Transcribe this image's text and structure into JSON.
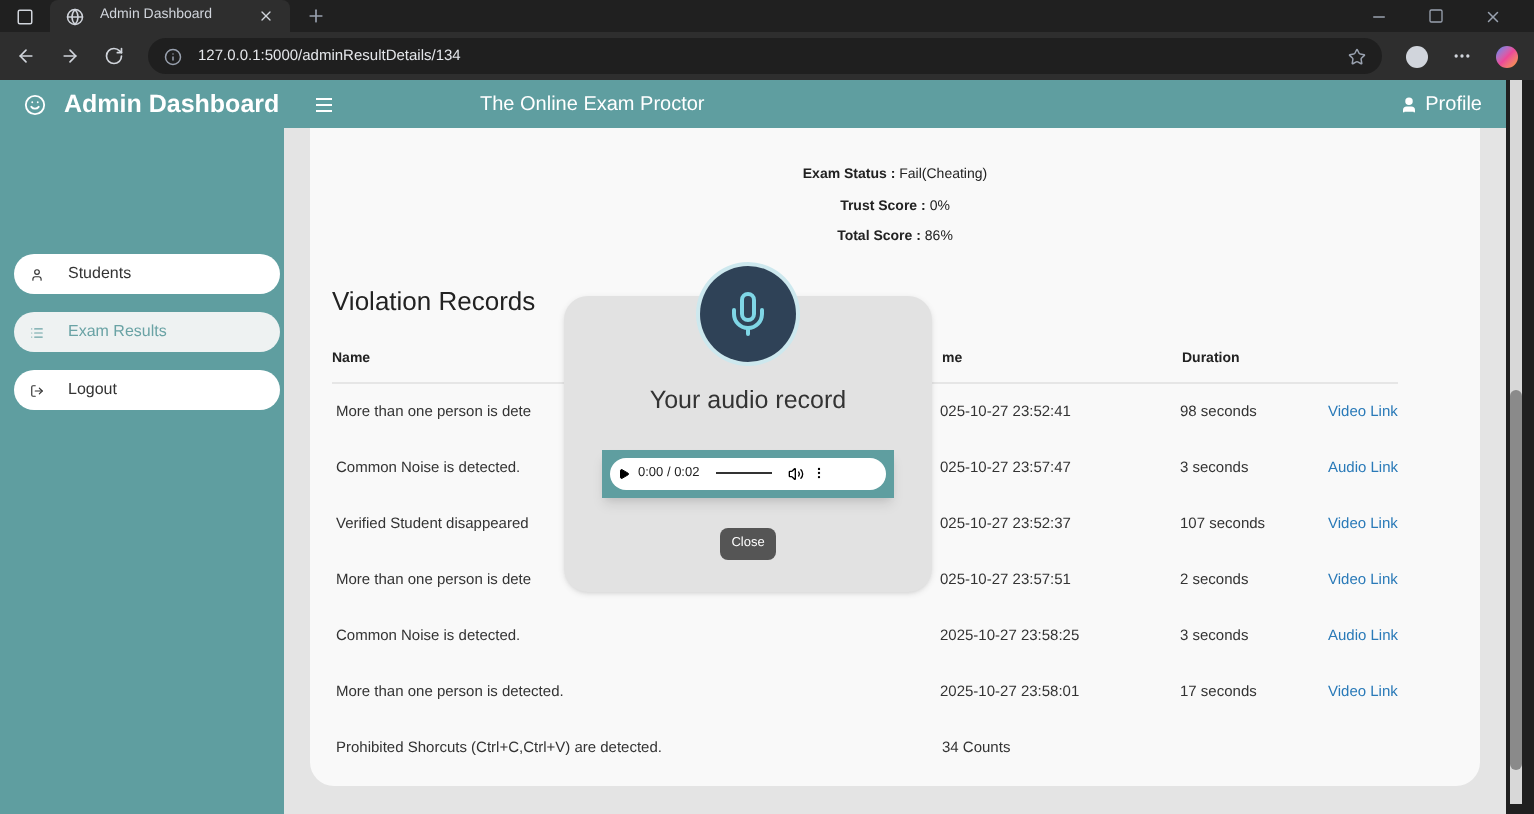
{
  "browser": {
    "tab_title": "Admin Dashboard",
    "url": "127.0.0.1:5000/adminResultDetails/134"
  },
  "header": {
    "title": "Admin Dashboard",
    "tagline": "The Online Exam Proctor",
    "profile": "Profile"
  },
  "sidebar": {
    "items": [
      {
        "label": "Students",
        "selected": false
      },
      {
        "label": "Exam Results",
        "selected": true
      },
      {
        "label": "Logout",
        "selected": false
      }
    ]
  },
  "summary": [
    {
      "label": "Exam Status :",
      "value": "Fail(Cheating)"
    },
    {
      "label": "Trust Score :",
      "value": "0%"
    },
    {
      "label": "Total Score :",
      "value": "86%"
    }
  ],
  "section_title": "Violation Records",
  "table": {
    "columns": [
      "Name",
      "me",
      "Duration"
    ],
    "rows": [
      {
        "name": "More than one person is dete",
        "time": "025-10-27 23:52:41",
        "duration": "98 seconds",
        "link": "Video Link"
      },
      {
        "name": "Common Noise is detected.",
        "time": "025-10-27 23:57:47",
        "duration": "3 seconds",
        "link": "Audio Link"
      },
      {
        "name": "Verified Student disappeared",
        "time": "025-10-27 23:52:37",
        "duration": "107 seconds",
        "link": "Video Link"
      },
      {
        "name": "More than one person is dete",
        "time": "025-10-27 23:57:51",
        "duration": "2 seconds",
        "link": "Video Link"
      },
      {
        "name": "Common Noise is detected.",
        "time": "2025-10-27 23:58:25",
        "duration": "3 seconds",
        "link": "Audio Link"
      },
      {
        "name": "More than one person is detected.",
        "time": "2025-10-27 23:58:01",
        "duration": "17 seconds",
        "link": "Video Link"
      },
      {
        "name": "Prohibited Shorcuts (Ctrl+C,Ctrl+V) are detected.",
        "time": "34 Counts"
      }
    ]
  },
  "modal": {
    "title": "Your audio record",
    "player_time": "0:00 / 0:02",
    "close": "Close"
  }
}
